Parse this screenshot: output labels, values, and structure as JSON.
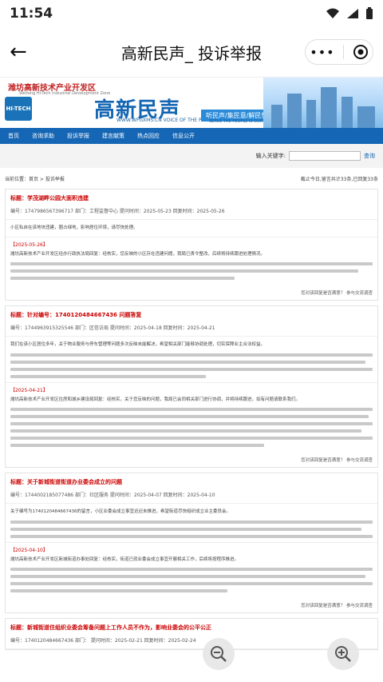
{
  "status": {
    "time": "11:54"
  },
  "titlebar": {
    "title": "高新民声_ 投诉举报"
  },
  "banner": {
    "org": "潍坊高新技术产业开发区",
    "org_en": "Weifang Hi-Tech Industrial Development Zone",
    "hitech": "HI-TECH",
    "brand": "高新民声",
    "url": "WWW.WFGXMS.CN  VOICE OF THE PEOPLE",
    "slogan": "听民声/集民意/解民忧",
    "motto": "SERVE THE PEOPLE IS OUR MOTTO"
  },
  "nav": [
    "首页",
    "咨询求助",
    "投诉举报",
    "建言献策",
    "热点回应",
    "信息公开"
  ],
  "search": {
    "label": "输入关键字:",
    "button": "查询"
  },
  "crumb": {
    "path": "当前位置：首页 > 投诉举报",
    "stats": "截止今日,留言共计33条,已回复33条"
  },
  "items": [
    {
      "title": "标题：学茂湖畔公园大面积违建",
      "meta": "编号：174798656739671​7  部门：工程监督中心  提问时间：2025-05-23  回复时间：2025-05-26",
      "body": "小区私自在该地块违建，圈占绿地，影响居住环境，请尽快处理。",
      "reply_head": "【2025-05-26】",
      "reply": "潍坊高新技术产业开发区经办行政执法局回复：经核实，您反映的小区存在违建问题，我局已责令整改，后续将持续跟进处理情况。",
      "footer": "您对该回复是否满意？ 参与交流调查"
    },
    {
      "title": "标题：针对编号：1740120484667436 问题答复",
      "meta": "编号：1744963915325546  部门：区信访局  提问时间：2025-04-18  回复时间：2025-04-21",
      "body": "我们在该小区居住多年，关于物业服务与停车管理等问题多次反映未能解决，希望相关部门能够协调处理，切实保障业主合法权益。",
      "reply_head": "【2025-04-21】",
      "reply": "潍坊高新技术产业开发区住房和城乡建设局回复：经核实，关于您反映的问题，我局已会同相关部门进行协调，并将持续跟进，如有问题请联系我们。",
      "footer": "您对该回复是否满意？ 参与交流调查"
    },
    {
      "title": "标题：关于新城街道街道办业委会成立的问题",
      "meta": "编号：1744002185077486  部门：社区服务  提问时间：2025-04-07  回复时间：2025-04-10",
      "body": "关于编号为1740120484667436的留言，小区业委会成立事宜迟迟未推进，希望街道尽快组织成立业主委员会。",
      "reply_head": "【2025-04-10】",
      "reply": "潍坊高新技术产业开发区新城街道办事处回复：经核实，街道已就业委会成立事宜开展相关工作，后续将按程序推进。",
      "footer": "您对该回复是否满意？ 参与交流调查"
    },
    {
      "title": "标题：新城街道住组织业委会筹备问题上工作人员不作为，影响业委会的公平公正",
      "meta": "编号：1740120484667436  部门：  提问时间：2025-02-21  回复时间：2025-02-24"
    }
  ]
}
